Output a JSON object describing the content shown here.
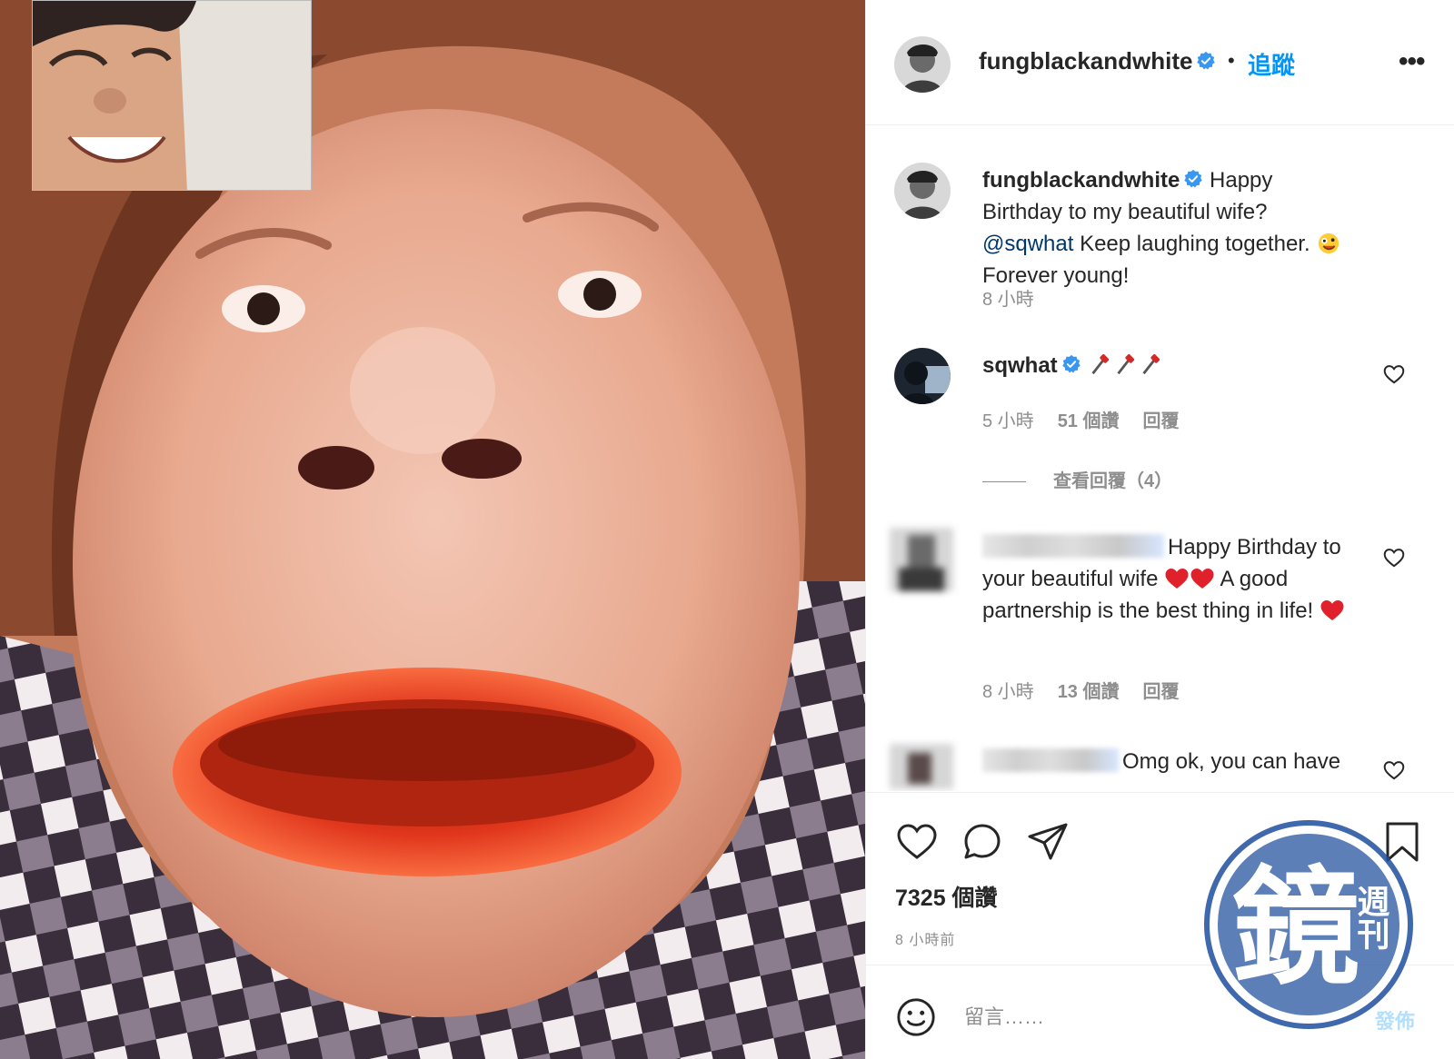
{
  "post": {
    "username": "fungblackandwhite",
    "follow_label": "追蹤",
    "separator": "•",
    "more_label": "•••",
    "verified_icon": "verified-badge-icon"
  },
  "caption": {
    "username": "fungblackandwhite",
    "text_before_mention": " Happy Birthday to my beautiful wife? ",
    "mention": "@sqwhat",
    "text_after_mention": " Keep laughing together. ",
    "emoji": "zany-face-emoji",
    "text_end": " Forever young!",
    "time": "8 小時"
  },
  "comments": [
    {
      "username": "sqwhat",
      "text": "",
      "emoji": [
        "pushpin-emoji",
        "pushpin-emoji",
        "pushpin-emoji"
      ],
      "time": "5 小時",
      "likes": "51 個讚",
      "reply_label": "回覆",
      "view_replies": "查看回覆（4）"
    },
    {
      "username": "",
      "username_blurred": true,
      "text_1": "Happy Birthday to your beautiful wife ",
      "text_2": " A good partnership is the best thing in life! ",
      "time": "8 小時",
      "likes": "13 個讚",
      "reply_label": "回覆"
    },
    {
      "username": "",
      "username_blurred": true,
      "text": "Omg ok, you can have"
    }
  ],
  "actions": {
    "like_icon": "heart-icon",
    "comment_icon": "comment-icon",
    "share_icon": "share-icon",
    "save_icon": "bookmark-icon",
    "likes_count": "7325 個讚",
    "time_ago": "8 小時前"
  },
  "composer": {
    "emoji_icon": "smiley-icon",
    "placeholder": "留言……",
    "publish_label": "發佈"
  },
  "watermark": {
    "text": "鏡",
    "subtext": "週刊"
  },
  "colors": {
    "accent": "#0095f6",
    "verified": "#3897f0",
    "muted": "#8e8e8e",
    "heart_red": "#e0202a"
  }
}
